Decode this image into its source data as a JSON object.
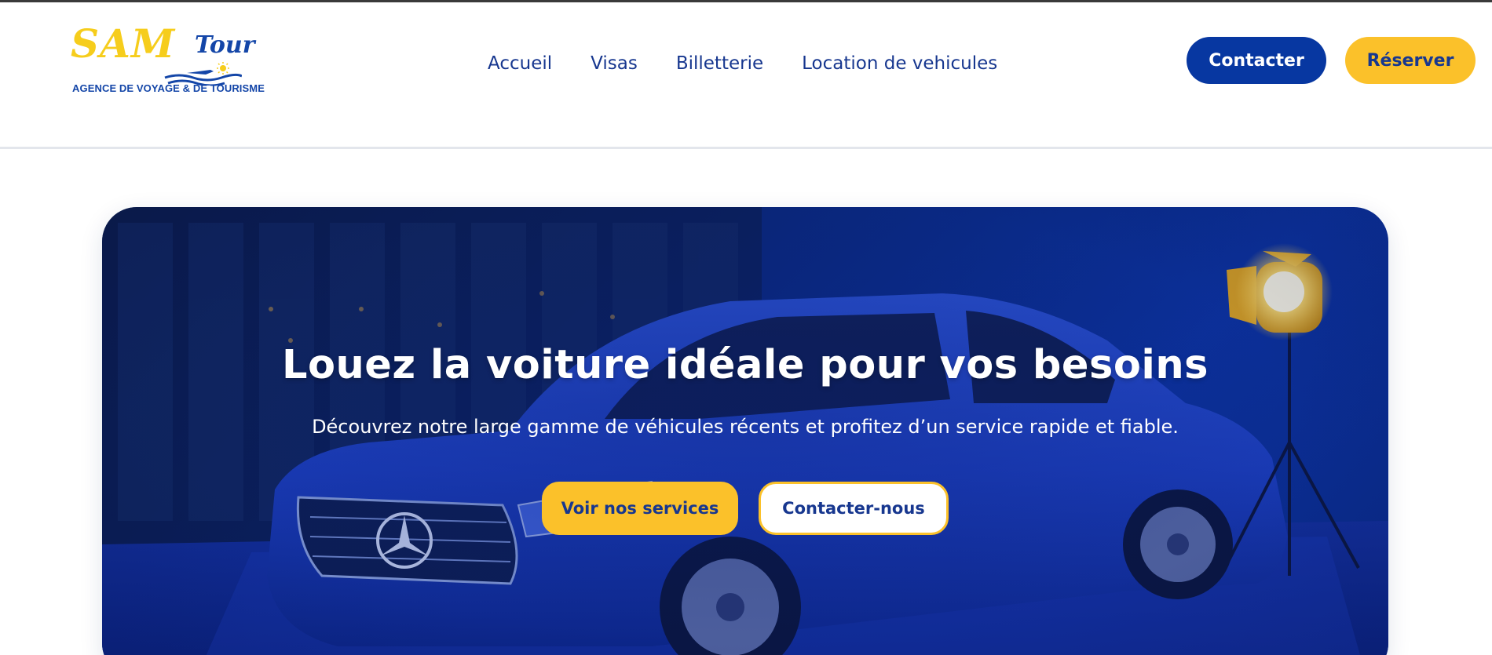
{
  "brand": {
    "logo_main": "SAM",
    "logo_sub": "Tour",
    "tagline": "AGENCE DE VOYAGE & DE TOURISME",
    "primary_color": "#0737a1",
    "accent_color": "#fbc12a"
  },
  "nav": {
    "items": [
      {
        "label": "Accueil"
      },
      {
        "label": "Visas"
      },
      {
        "label": "Billetterie"
      },
      {
        "label": "Location de vehicules"
      }
    ]
  },
  "header_actions": {
    "contact_label": "Contacter",
    "reserve_label": "Réserver"
  },
  "hero": {
    "title": "Louez la voiture idéale pour vos besoins",
    "subtitle": "Découvrez notre large gamme de véhicules récents et profitez d’un service rapide et fiable.",
    "primary_button": "Voir nos services",
    "secondary_button": "Contacter-nous"
  }
}
